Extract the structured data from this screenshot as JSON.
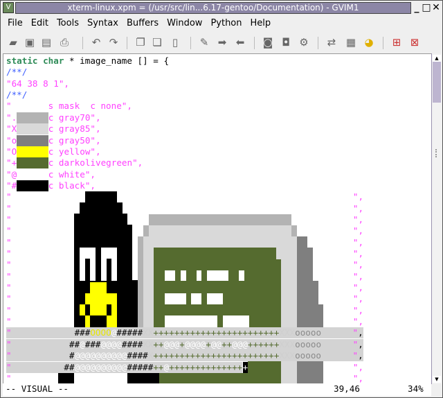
{
  "window": {
    "title": "xterm-linux.xpm = (/usr/src/lin...6.17-gentoo/Documentation) - GVIM1",
    "minimize": "_",
    "maximize": "□",
    "close": "✕"
  },
  "menu": [
    {
      "label": "File"
    },
    {
      "label": "Edit"
    },
    {
      "label": "Tools"
    },
    {
      "label": "Syntax"
    },
    {
      "label": "Buffers"
    },
    {
      "label": "Window"
    },
    {
      "label": "Python"
    },
    {
      "label": "Help"
    }
  ],
  "toolbar": [
    "open-icon",
    "save-icon",
    "save-all-icon",
    "print-icon",
    "undo-icon",
    "redo-icon",
    "cut-icon",
    "copy-icon",
    "paste-icon",
    "replace-icon",
    "find-next-icon",
    "find-prev-icon",
    "load-session-icon",
    "save-session-icon",
    "run-script-icon",
    "make-icon",
    "tag-list-icon",
    "jump-tag-icon",
    "new-window-icon",
    "split-window-icon"
  ],
  "code": {
    "l1_kw": "static char",
    "l1_rest": " * image_name [] = {",
    "comment": "/**/",
    "l3": "\"64 38 8 1\",",
    "l5": "\"       s mask  c none\",",
    "colors": [
      {
        "ch": "\".",
        "name": "c gray70\",",
        "hex": "#b3b3b3"
      },
      {
        "ch": "\"X",
        "name": "c gray85\",",
        "hex": "#d9d9d9"
      },
      {
        "ch": "\"o",
        "name": "c gray50\",",
        "hex": "#7f7f7f"
      },
      {
        "ch": "\"O",
        "name": "c yellow\",",
        "hex": "#ffff00"
      },
      {
        "ch": "\"+",
        "name": "c darkolivegreen\",",
        "hex": "#556b2f"
      },
      {
        "ch": "\"@",
        "name": "c white\",",
        "hex": "#ffffff"
      },
      {
        "ch": "\"#",
        "name": "c black\",",
        "hex": "#000000"
      }
    ],
    "quote": "\"",
    "line_end": "\",",
    "selected_rows": [
      "\"            ###OOOO@#####XX++++++++++++++++++++++++XXXooooo      \",",
      "\"           ##@###@@@@####XX++@@@+@@@@+@@++@@@++++++XXXooooo      \",",
      "\"           #@@@@@@@@@@####X++++++++++++++++++++++++XXXooooo      \",",
      "\"          ##@@@@@@@@@@#####++@++++++++++++++"
    ],
    "cursor_char": "+"
  },
  "status": {
    "mode": "-- VISUAL --",
    "position": "39,46",
    "percent": "34%"
  }
}
